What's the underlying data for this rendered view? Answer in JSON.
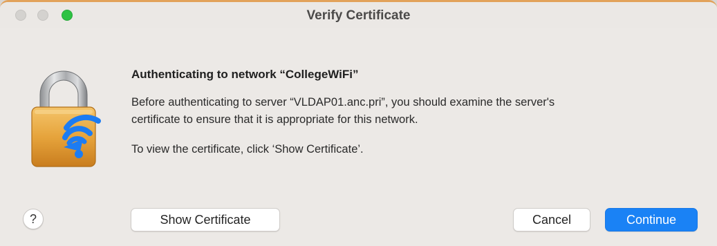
{
  "window": {
    "title": "Verify Certificate"
  },
  "dialog": {
    "heading": "Authenticating to network “CollegeWiFi”",
    "message_line1": "Before authenticating to server “VLDAP01.anc.pri”, you should examine the server's",
    "message_line2": "certificate to ensure that it is appropriate for this network.",
    "instruction": "To view the certificate, click ‘Show Certificate’.",
    "icon": "lock-wifi-icon"
  },
  "buttons": {
    "help": "?",
    "show_certificate": "Show Certificate",
    "cancel": "Cancel",
    "continue": "Continue"
  },
  "colors": {
    "accent": "#1a82f5",
    "zoom": "#2ec243",
    "window_bg": "#ece9e6"
  }
}
